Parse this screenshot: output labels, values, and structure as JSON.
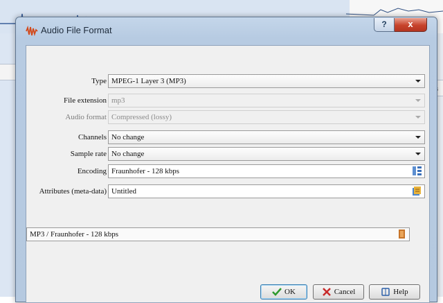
{
  "background": {
    "tab_label": "nes",
    "ruler_label": "35 s"
  },
  "dialog": {
    "title": "Audio File Format",
    "help_glyph": "?",
    "close_glyph": "x"
  },
  "form": {
    "type": {
      "label": "Type",
      "value": "MPEG-1 Layer 3 (MP3)"
    },
    "file_extension": {
      "label": "File extension",
      "value": "mp3"
    },
    "audio_format": {
      "label": "Audio format",
      "value": "Compressed (lossy)"
    },
    "channels": {
      "label": "Channels",
      "value": "No change"
    },
    "sample_rate": {
      "label": "Sample rate",
      "value": "No change"
    },
    "encoding": {
      "label": "Encoding",
      "value": "Fraunhofer - 128 kbps"
    },
    "attributes": {
      "label": "Attributes (meta-data)",
      "value": "Untitled"
    },
    "summary": {
      "value": "MP3 / Fraunhofer - 128 kbps"
    }
  },
  "buttons": {
    "ok": "OK",
    "cancel": "Cancel",
    "help": "Help"
  },
  "colors": {
    "ok_check": "#2e9a2e",
    "cancel_x": "#c82a2a",
    "help_book": "#2b5fa8",
    "title_bar": "#b7cbe2",
    "close_button": "#c7432c"
  }
}
